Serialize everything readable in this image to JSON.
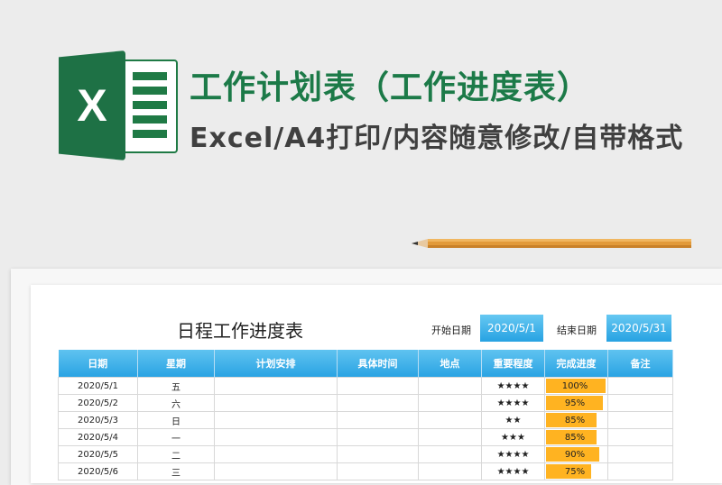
{
  "header": {
    "logo_letter": "X",
    "title": "工作计划表（工作进度表）",
    "subtitle": "Excel/A4打印/内容随意修改/自带格式"
  },
  "colors": {
    "brand_green": "#1c7a48",
    "header_blue": "#2aa3e3",
    "progress": "#ffb321",
    "stars": "#f08d1e"
  },
  "sheet": {
    "title": "日程工作进度表",
    "start_label": "开始日期",
    "start_value": "2020/5/1",
    "end_label": "结束日期",
    "end_value": "2020/5/31"
  },
  "table": {
    "columns": [
      "日期",
      "星期",
      "计划安排",
      "具体时间",
      "地点",
      "重要程度",
      "完成进度",
      "备注"
    ],
    "rows": [
      {
        "date": "2020/5/1",
        "weekday": "五",
        "plan": "",
        "time": "",
        "place": "",
        "importance": "★★★★",
        "progress": 100,
        "progress_text": "100%",
        "note": ""
      },
      {
        "date": "2020/5/2",
        "weekday": "六",
        "plan": "",
        "time": "",
        "place": "",
        "importance": "★★★★",
        "progress": 95,
        "progress_text": "95%",
        "note": ""
      },
      {
        "date": "2020/5/3",
        "weekday": "日",
        "plan": "",
        "time": "",
        "place": "",
        "importance": "★★",
        "progress": 85,
        "progress_text": "85%",
        "note": ""
      },
      {
        "date": "2020/5/4",
        "weekday": "一",
        "plan": "",
        "time": "",
        "place": "",
        "importance": "★★★",
        "progress": 85,
        "progress_text": "85%",
        "note": ""
      },
      {
        "date": "2020/5/5",
        "weekday": "二",
        "plan": "",
        "time": "",
        "place": "",
        "importance": "★★★★",
        "progress": 90,
        "progress_text": "90%",
        "note": ""
      },
      {
        "date": "2020/5/6",
        "weekday": "三",
        "plan": "",
        "time": "",
        "place": "",
        "importance": "★★★★",
        "progress": 75,
        "progress_text": "75%",
        "note": ""
      }
    ]
  }
}
